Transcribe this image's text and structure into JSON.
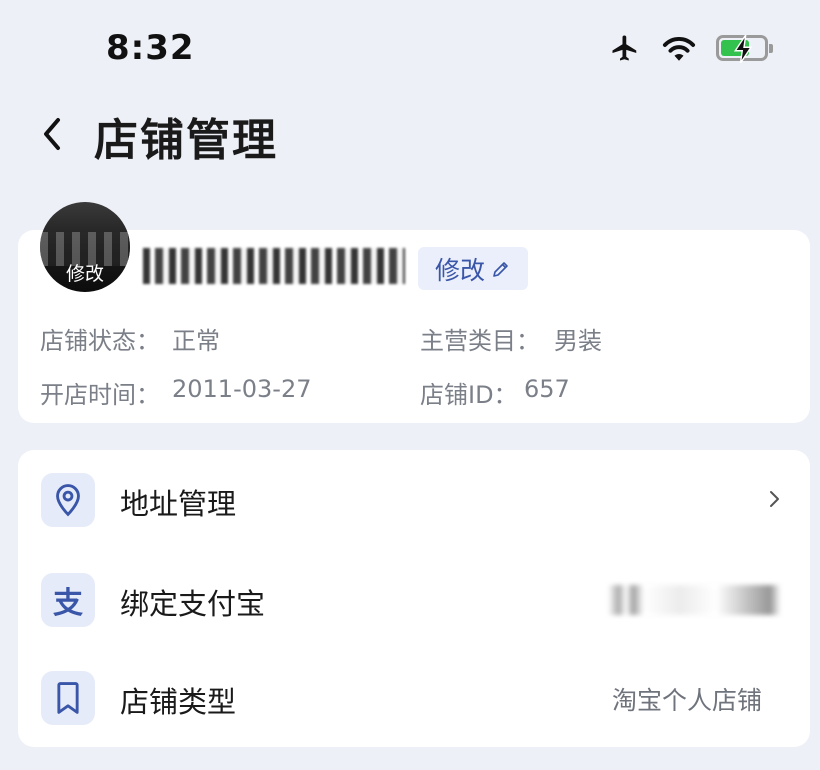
{
  "status_bar": {
    "time": "8:32",
    "icons": [
      "airplane-icon",
      "wifi-icon",
      "battery-charging-icon"
    ],
    "battery_color": "#33c24d"
  },
  "nav": {
    "title": "店铺管理",
    "back_icon": "chevron-left-icon"
  },
  "shop": {
    "avatar_edit_label": "修改",
    "edit_button_label": "修改",
    "status_label": "店铺状态：",
    "status_value": "正常",
    "category_label": "主营类目：",
    "category_value": "男装",
    "open_date_label": "开店时间：",
    "open_date_value": "2011-03-27",
    "shop_id_label": "店铺ID：",
    "shop_id_value": "657"
  },
  "menu": {
    "items": [
      {
        "label": "地址管理",
        "icon": "location-pin-icon",
        "value": ""
      },
      {
        "label": "绑定支付宝",
        "icon": "alipay-icon",
        "icon_glyph": "支",
        "value": ""
      },
      {
        "label": "店铺类型",
        "icon": "bookmark-icon",
        "value": "淘宝个人店铺"
      }
    ]
  },
  "colors": {
    "accent": "#3a56a8",
    "background": "#eef0f7",
    "icon_bg": "#e6ebf9"
  }
}
